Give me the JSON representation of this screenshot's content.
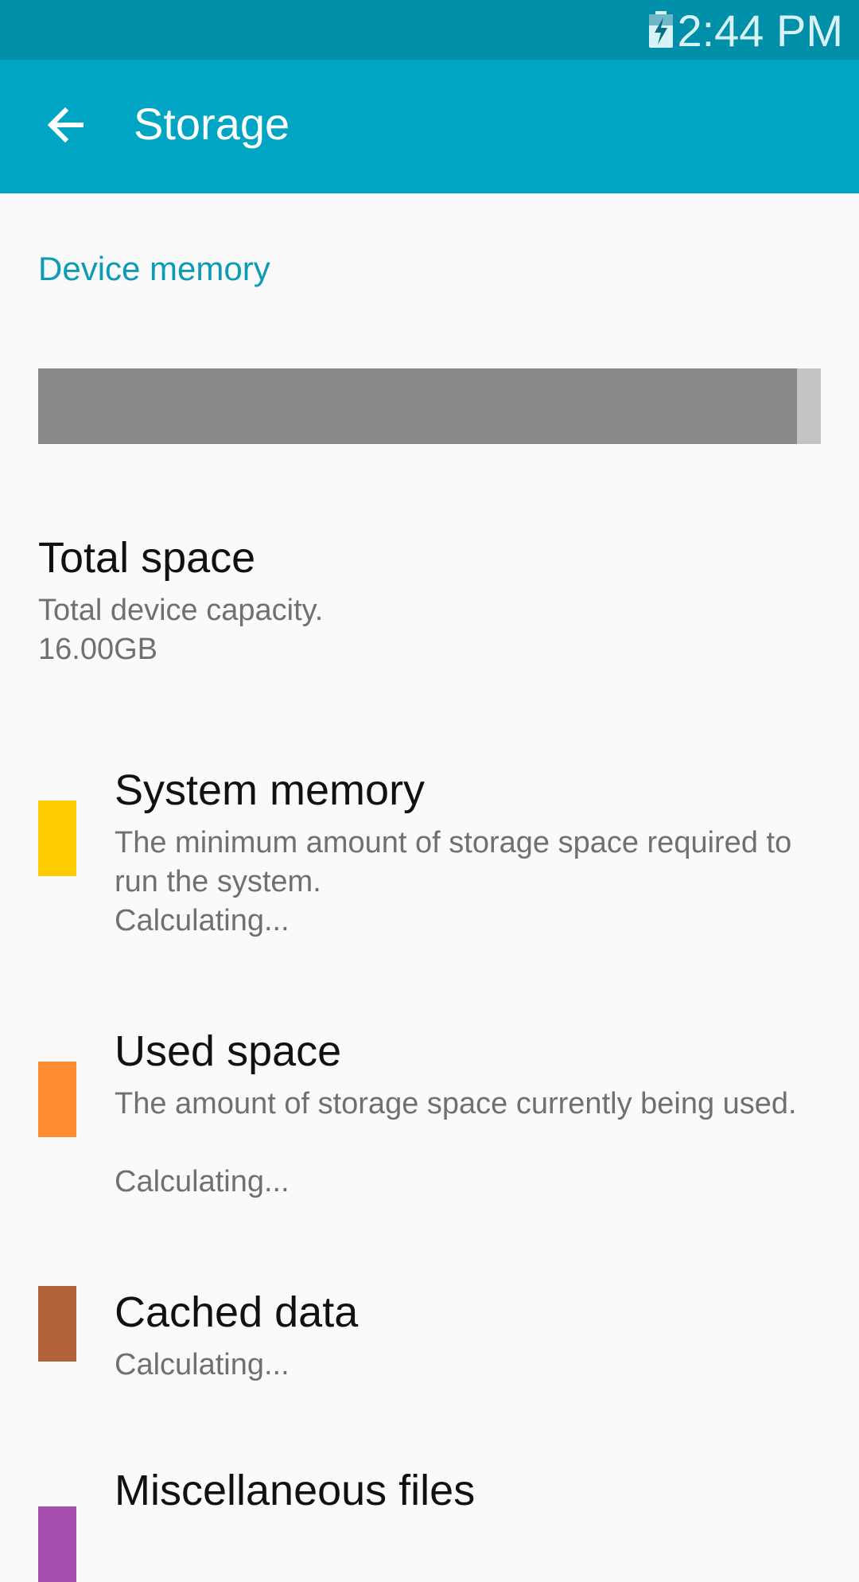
{
  "status_bar": {
    "time": "2:44 PM",
    "battery_icon": "battery-charging-icon"
  },
  "app_bar": {
    "back_icon": "arrow-back-icon",
    "title": "Storage"
  },
  "section": {
    "header": "Device memory"
  },
  "usage_bar": {
    "used_fraction": 0.97,
    "colors": {
      "used": "#898989",
      "free": "#c3c3c3"
    }
  },
  "total_space": {
    "title": "Total space",
    "description": "Total device capacity.",
    "value": "16.00GB"
  },
  "categories": [
    {
      "title": "System memory",
      "description": "The minimum amount of storage space required to run the system.",
      "status": "Calculating...",
      "color": "#ffcc00"
    },
    {
      "title": "Used space",
      "description": "The amount of storage space currently being used.",
      "status": "Calculating...",
      "color": "#ff8c33"
    },
    {
      "title": "Cached data",
      "description": "",
      "status": "Calculating...",
      "color": "#b2623a"
    },
    {
      "title": "Miscellaneous files",
      "description": "",
      "status": "",
      "color": "#a64fae"
    }
  ]
}
